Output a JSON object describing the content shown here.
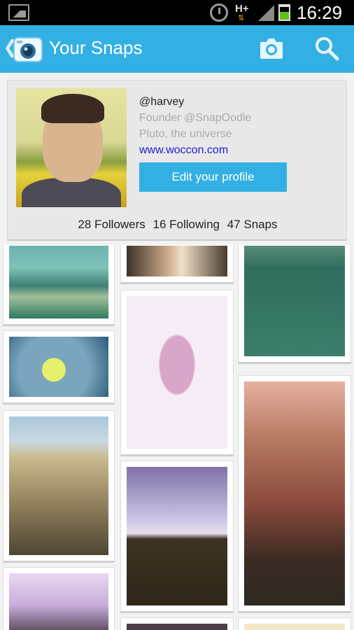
{
  "status_bar": {
    "network": "H+",
    "time": "16:29"
  },
  "action_bar": {
    "title": "Your Snaps",
    "back_glyph": "❮"
  },
  "profile": {
    "handle": "@harvey",
    "bio": "Founder @SnapOodle",
    "location": "Pluto, the universe",
    "website": "www.woccon.com",
    "edit_button": "Edit your profile",
    "stats": {
      "followers": "28 Followers",
      "following": "16 Following",
      "snaps": "47 Snaps"
    }
  },
  "snaps": [
    {
      "name": "snap-airport",
      "column": 1,
      "subject": "airplane at airport"
    },
    {
      "name": "snap-window-light",
      "column": 2,
      "subject": "window light"
    },
    {
      "name": "snap-tennis-court",
      "column": 3,
      "subject": "tennis court"
    },
    {
      "name": "snap-selfie",
      "column": 2,
      "subject": "portrait"
    },
    {
      "name": "snap-tennis-ball",
      "column": 1,
      "subject": "tennis ball in hand"
    },
    {
      "name": "snap-college-building",
      "column": 1,
      "subject": "gothic building"
    },
    {
      "name": "snap-chapel-window",
      "column": 3,
      "subject": "chapel window"
    },
    {
      "name": "snap-chapel-silhouette",
      "column": 2,
      "subject": "chapel silhouette"
    },
    {
      "name": "snap-spires",
      "column": 1,
      "subject": "spires"
    },
    {
      "name": "snap-partial-center",
      "column": 2,
      "subject": "partially visible"
    },
    {
      "name": "snap-partial-right",
      "column": 3,
      "subject": "partially visible"
    }
  ],
  "colors": {
    "accent": "#33b0e3",
    "link": "#1b1bd6",
    "status_bar": "#000000"
  }
}
